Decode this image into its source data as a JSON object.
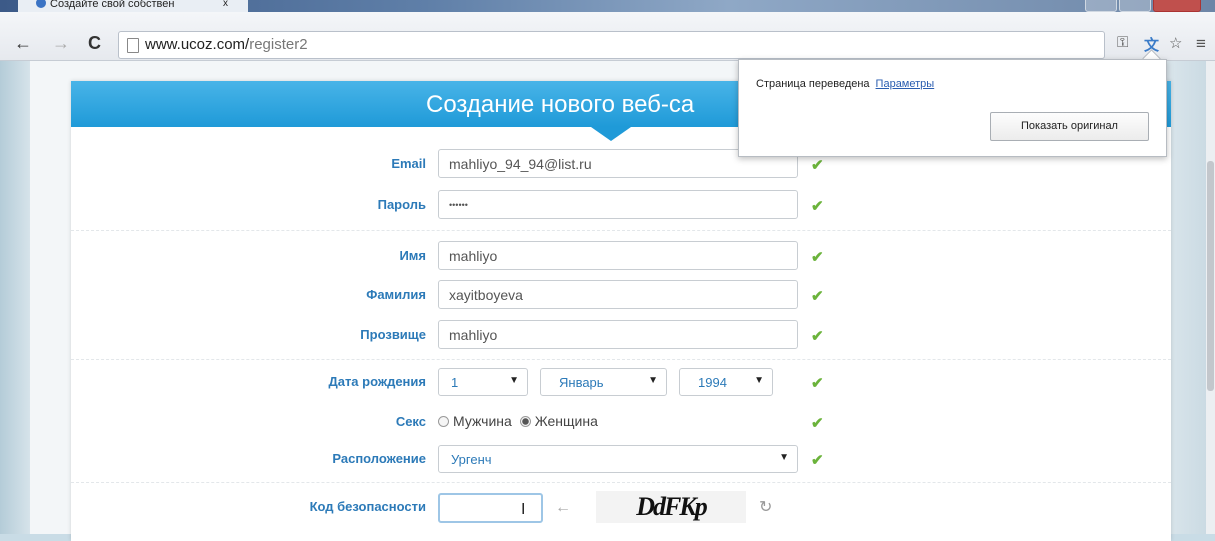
{
  "browser": {
    "tab_title": "Создайте свой собствен",
    "tab_close": "x",
    "url_host": "www.ucoz.com/",
    "url_path": "register2"
  },
  "icons": {
    "back": "arrow-left-icon",
    "forward": "arrow-right-icon",
    "reload": "reload-icon",
    "translate": "translate-icon",
    "star": "star-icon",
    "menu": "menu-icon",
    "checkmark": "checkmark-icon",
    "captcha_back": "arrow-left-icon",
    "captcha_refresh": "refresh-icon"
  },
  "colors": {
    "header_blue": "#1f9ad8",
    "label_blue": "#2c7ab8",
    "valid_green": "#6bb33b"
  },
  "translate_popup": {
    "message": "Страница переведена",
    "options_link": "Параметры",
    "show_original_button": "Показать оригинал"
  },
  "form": {
    "title": "Создание нового веб-са",
    "fields": {
      "email": {
        "label": "Email",
        "value": "mahliyo_94_94@list.ru"
      },
      "password": {
        "label": "Пароль",
        "value": "••••••"
      },
      "first_name": {
        "label": "Имя",
        "value": "mahliyo"
      },
      "last_name": {
        "label": "Фамилия",
        "value": "xayitboyeva"
      },
      "nickname": {
        "label": "Прозвище",
        "value": "mahliyo"
      }
    },
    "birthdate": {
      "label": "Дата рождения",
      "day": "1",
      "month": "Январь",
      "year": "1994"
    },
    "gender": {
      "label": "Секс",
      "male": "Мужчина",
      "female": "Женщина",
      "selected": "female"
    },
    "location": {
      "label": "Расположение",
      "value": "Ургенч"
    },
    "captcha": {
      "label": "Код безопасности",
      "value": "",
      "image_text": "DdFKp"
    }
  }
}
